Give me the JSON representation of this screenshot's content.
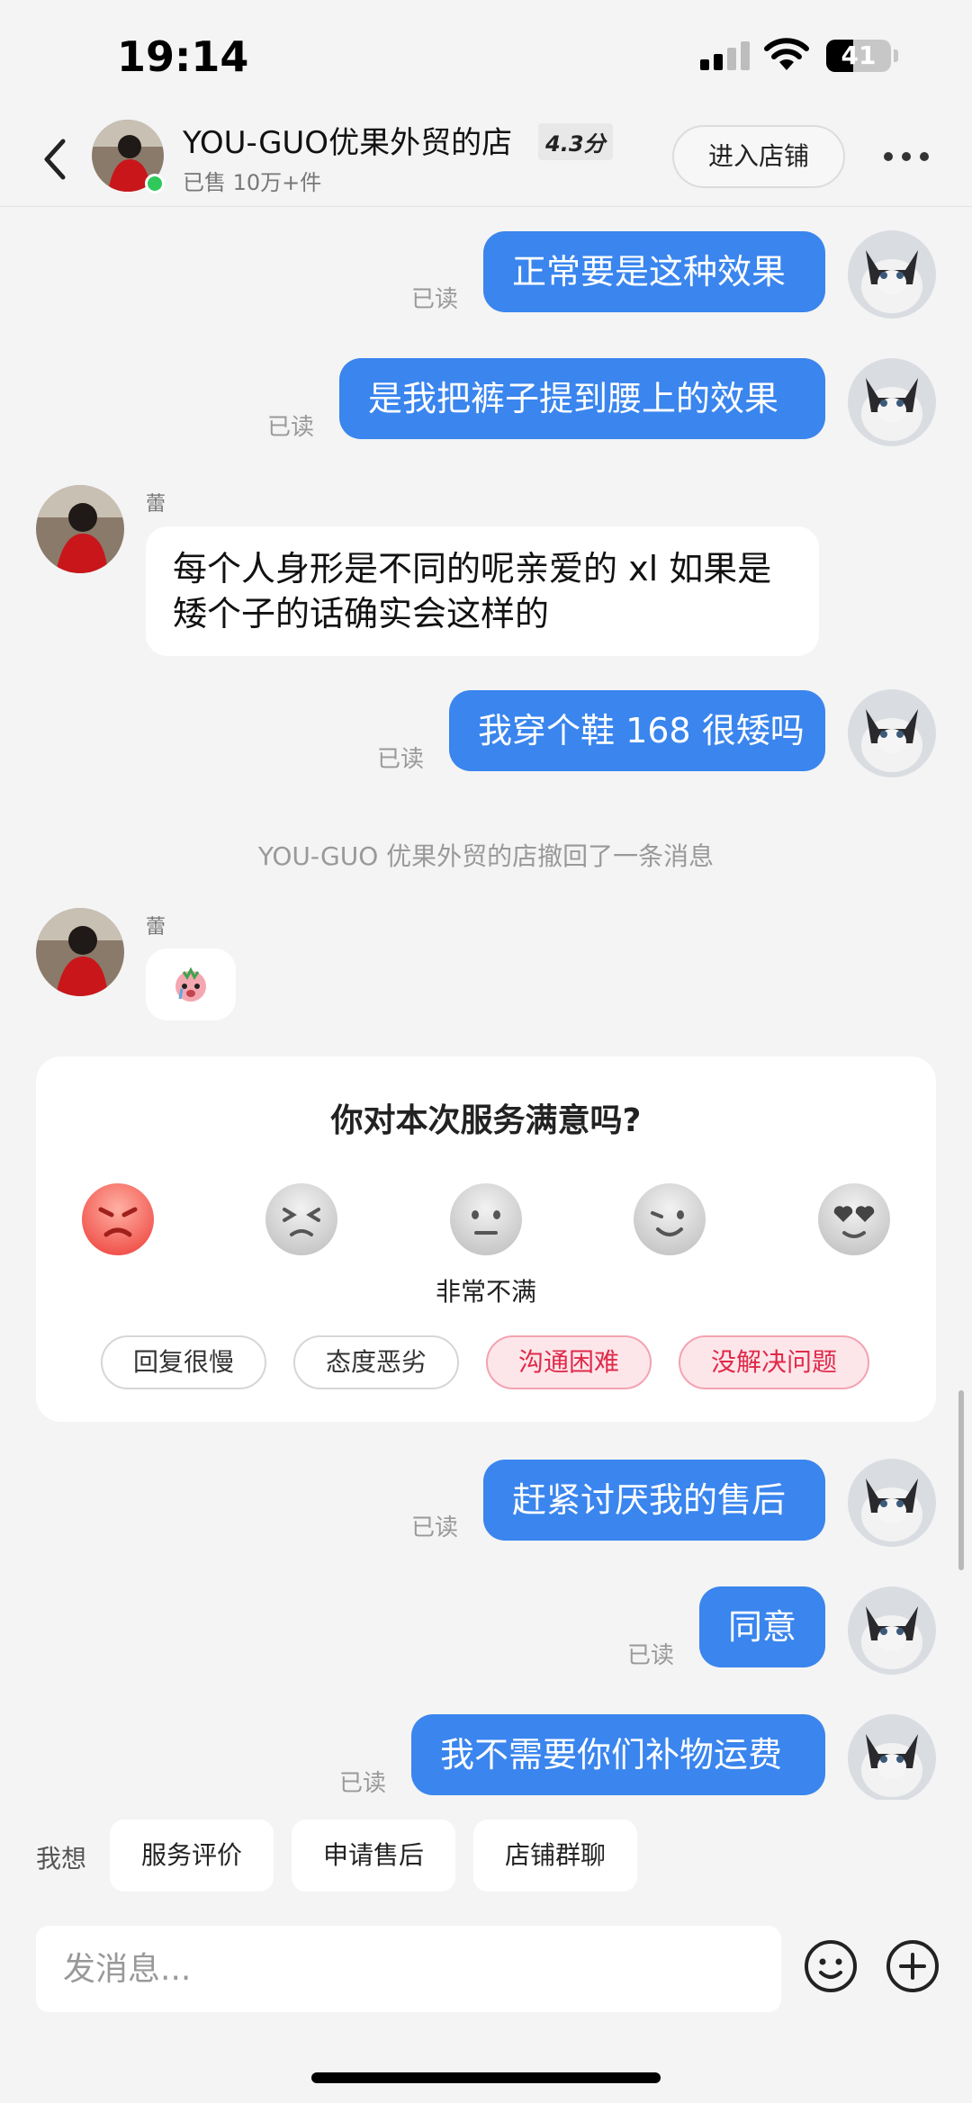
{
  "status_bar": {
    "time": "19:14",
    "battery_level": "41",
    "battery_fraction": 0.41
  },
  "header": {
    "shop_name": "YOU-GUO优果外贸的店",
    "score": "4.3分",
    "sold": "已售 10万+件",
    "enter_shop": "进入店铺",
    "online": true
  },
  "messages": [
    {
      "from": "me",
      "text": "正常要是这种效果",
      "status": "已读"
    },
    {
      "from": "me",
      "text": "是我把裤子提到腰上的效果",
      "status": "已读"
    },
    {
      "from": "them",
      "sender": "蕾",
      "text": "每个人身形是不同的呢亲爱的 xl 如果是矮个子的话确实会这样的"
    },
    {
      "from": "me",
      "text": "我穿个鞋 168 很矮吗",
      "status": "已读"
    },
    {
      "type": "recall",
      "text": "YOU-GUO 优果外贸的店撤回了一条消息"
    },
    {
      "from": "them",
      "sender": "蕾",
      "sticker": "crying-sticker"
    },
    {
      "from": "me",
      "text": "赶紧讨厌我的售后",
      "status": "已读"
    },
    {
      "from": "me",
      "text": "同意",
      "status": "已读"
    },
    {
      "from": "me",
      "text": "我不需要你们补物运费",
      "status": "已读"
    }
  ],
  "rating": {
    "title": "你对本次服务满意吗?",
    "faces": [
      "angry-face-icon",
      "frustrated-face-icon",
      "neutral-face-icon",
      "smiling-face-icon",
      "heart-eyes-face-icon"
    ],
    "selected_face": 1,
    "selected_label": "非常不满",
    "tags": [
      {
        "label": "回复很慢",
        "active": false
      },
      {
        "label": "态度恶劣",
        "active": false
      },
      {
        "label": "沟通困难",
        "active": true
      },
      {
        "label": "没解决问题",
        "active": true
      }
    ]
  },
  "quick_actions": {
    "label": "我想",
    "buttons": [
      "服务评价",
      "申请售后",
      "店铺群聊"
    ]
  },
  "input": {
    "placeholder": "发消息..."
  },
  "colors": {
    "bubble_me": "#3a85ee",
    "chip_active_bg": "#fde6ea",
    "chip_active_text": "#e02a4a",
    "online_dot": "#2fc85b"
  }
}
